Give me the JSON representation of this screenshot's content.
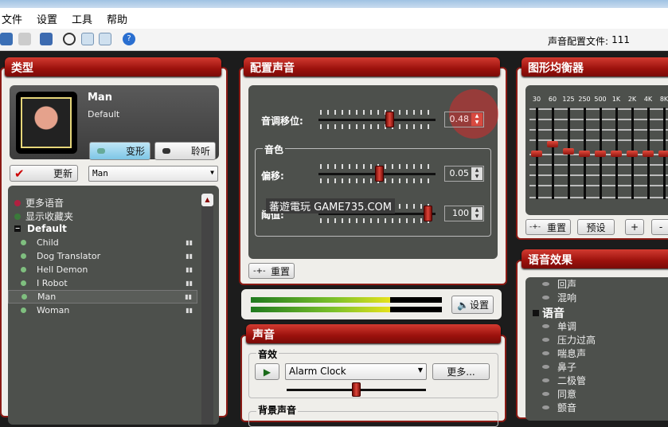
{
  "menu": [
    "文件",
    "设置",
    "工具",
    "帮助"
  ],
  "toolbar": {
    "profile_file_label": "声音配置文件:",
    "profile_file_value": "111"
  },
  "type_panel": {
    "title": "类型",
    "voice_name": "Man",
    "voice_category": "Default",
    "morph_label": "变形",
    "listen_label": "聆听",
    "update_label": "更新",
    "voice_select": "Man",
    "list": {
      "more_voices": "更多语音",
      "show_favorites": "显示收藏夹",
      "group": "Default",
      "items": [
        "Child",
        "Dog Translator",
        "Hell Demon",
        "I Robot",
        "Man",
        "Woman"
      ],
      "selected": "Man"
    }
  },
  "config_panel": {
    "title": "配置声音",
    "pitch_label": "音调移位:",
    "pitch_value": "0.48",
    "timbre_group": "音色",
    "offset_label": "偏移:",
    "offset_value": "0.05",
    "threshold_label": "阈值:",
    "threshold_value": "100",
    "reset_label": "重置",
    "pitch_fraction": 0.62,
    "offset_fraction": 0.52,
    "threshold_fraction": 0.97
  },
  "watermark": "蕃遊電玩 GAME735.COM",
  "meter": {
    "level_fraction": 0.73,
    "settings_label": "设置"
  },
  "sound_panel": {
    "title": "声音",
    "effects_group": "音效",
    "effect_select": "Alarm Clock",
    "more_label": "更多...",
    "volume_fraction": 0.5,
    "background_group": "背景声音"
  },
  "eq_panel": {
    "title": "图形均衡器",
    "bands": [
      "30",
      "60",
      "125",
      "250",
      "500",
      "1K",
      "2K",
      "4K",
      "8K"
    ],
    "levels": [
      0,
      2,
      0.5,
      0,
      0,
      0,
      0,
      0,
      0
    ],
    "reset_label": "重置",
    "preset_label": "预设",
    "plus_label": "+",
    "minus_label": "-"
  },
  "effects_panel": {
    "title": "语音效果",
    "items_before": [
      "回声",
      "混响"
    ],
    "group": "语音",
    "items": [
      "单调",
      "压力过高",
      "喘息声",
      "鼻子",
      "二极管",
      "同意",
      "颤音"
    ]
  },
  "colors": {
    "accent": "#b0170f",
    "panel_dark": "#4d504c"
  }
}
